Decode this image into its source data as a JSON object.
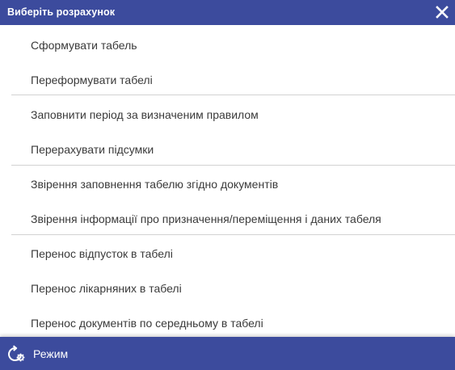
{
  "dialog": {
    "title": "Виберіть розрахунок"
  },
  "colors": {
    "header_bg": "#3c4b9d",
    "text": "#3a3a3a",
    "separator": "#d2d2d2"
  },
  "menu": {
    "items": [
      {
        "label": "Сформувати табель"
      },
      {
        "label": "Переформувати табелі"
      },
      {
        "label": "Заповнити період за визначеним правилом"
      },
      {
        "label": "Перерахувати підсумки"
      },
      {
        "label": "Звірення заповнення табелю згідно документів"
      },
      {
        "label": "Звірення інформації про призначення/переміщення і даних табеля"
      },
      {
        "label": "Перенос відпусток в табелі"
      },
      {
        "label": "Перенос лікарняних в табелі"
      },
      {
        "label": "Перенос документів по середньому в табелі"
      }
    ]
  },
  "footer": {
    "mode_label": "Режим",
    "mode_icon": "refresh-gear-icon"
  }
}
